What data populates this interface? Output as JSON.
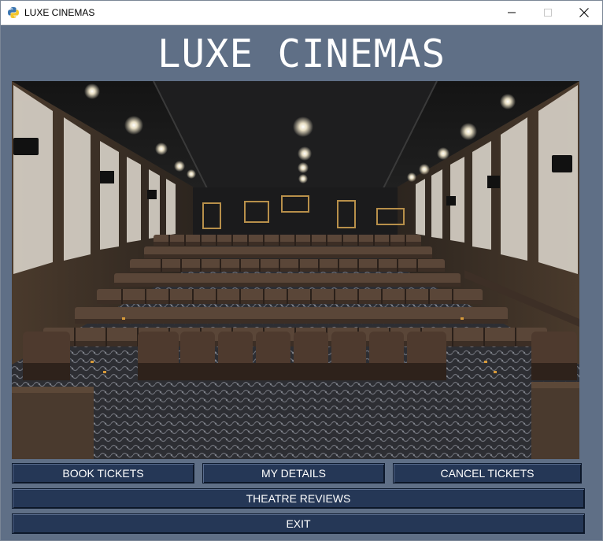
{
  "window": {
    "title": "LUXE CINEMAS",
    "icon": "python-feather-icon"
  },
  "header": {
    "heading": "LUXE CINEMAS"
  },
  "hero": {
    "icon": "cinema-auditorium-photo"
  },
  "buttons": {
    "book_tickets": "BOOK TICKETS",
    "my_details": "MY DETAILS",
    "cancel_tickets": "CANCEL TICKETS",
    "theatre_reviews": "THEATRE REVIEWS",
    "exit": "EXIT"
  },
  "colors": {
    "background": "#5f6f86",
    "button": "#253756",
    "text": "#ffffff"
  }
}
